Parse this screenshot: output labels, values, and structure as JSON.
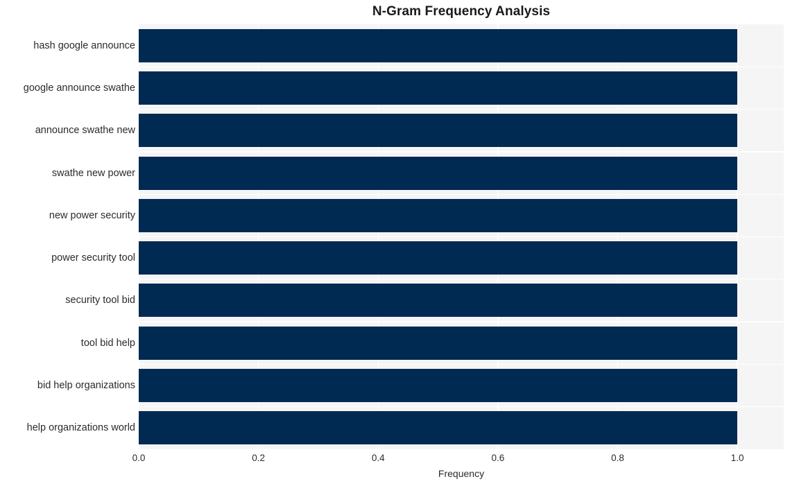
{
  "chart_data": {
    "type": "bar",
    "orientation": "horizontal",
    "title": "N-Gram Frequency Analysis",
    "xlabel": "Frequency",
    "ylabel": "",
    "categories": [
      "hash google announce",
      "google announce swathe",
      "announce swathe new",
      "swathe new power",
      "new power security",
      "power security tool",
      "security tool bid",
      "tool bid help",
      "bid help organizations",
      "help organizations world"
    ],
    "values": [
      1.0,
      1.0,
      1.0,
      1.0,
      1.0,
      1.0,
      1.0,
      1.0,
      1.0,
      1.0
    ],
    "xlim": [
      0.0,
      1.0775
    ],
    "xticks": [
      0.0,
      0.2,
      0.4,
      0.6,
      0.8,
      1.0
    ],
    "xtick_labels": [
      "0.0",
      "0.2",
      "0.4",
      "0.6",
      "0.8",
      "1.0"
    ],
    "grid": true,
    "grid_color": "#ffffff",
    "legend": "none",
    "bar_color": "#012a53",
    "plot_background": "#f5f5f6",
    "figure_background": "#ffffff",
    "text_color": "#2b2b2b",
    "title_color": "#1a1a1a"
  }
}
